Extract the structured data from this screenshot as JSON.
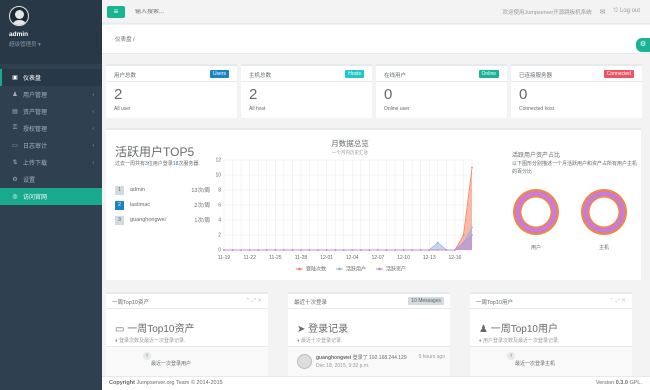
{
  "sidebar": {
    "user": "admin",
    "role": "超级管理员",
    "items": [
      {
        "label": "仪表盘",
        "icon": "dashboard-icon",
        "glyph": "▣",
        "arrow": ""
      },
      {
        "label": "用户管理",
        "icon": "users-icon",
        "glyph": "♟",
        "arrow": "‹"
      },
      {
        "label": "资产管理",
        "icon": "server-icon",
        "glyph": "▤",
        "arrow": "‹"
      },
      {
        "label": "授权管理",
        "icon": "lock-icon",
        "glyph": "⚿",
        "arrow": "‹"
      },
      {
        "label": "日志审计",
        "icon": "log-icon",
        "glyph": "▭",
        "arrow": "‹"
      },
      {
        "label": "上传下载",
        "icon": "upload-icon",
        "glyph": "⇅",
        "arrow": "‹"
      },
      {
        "label": "设置",
        "icon": "gear-icon",
        "glyph": "⚙",
        "arrow": ""
      },
      {
        "label": "访问官网",
        "icon": "globe-icon",
        "glyph": "◎",
        "arrow": ""
      }
    ]
  },
  "topbar": {
    "menu_glyph": "≡",
    "search_placeholder": "输入搜索...",
    "welcome": "欢迎使用Jumpserver开源跳板机系统",
    "logout": "Log out"
  },
  "breadcrumb": "仪表盘 /",
  "stats": [
    {
      "title": "用户总数",
      "badge": "Users",
      "badge_color": "#1c84c6",
      "value": "2",
      "sub": "All user"
    },
    {
      "title": "主机总数",
      "badge": "Hosts",
      "badge_color": "#23c6c8",
      "value": "2",
      "sub": "All host"
    },
    {
      "title": "在线用户",
      "badge": "Online",
      "badge_color": "#1ab394",
      "value": "0",
      "sub": "Online user"
    },
    {
      "title": "已连接服务器",
      "badge": "Connected",
      "badge_color": "#ed5565",
      "value": "0",
      "sub": "Connected host"
    }
  ],
  "top5": {
    "title": "活跃用户TOP5",
    "desc_pre": "过去一周共有",
    "desc_users": "3",
    "desc_mid": "位用户登录",
    "desc_hosts": "18",
    "desc_post": "次服务器.",
    "ranks": [
      {
        "num": "1",
        "name": "admin",
        "count": "13次/周"
      },
      {
        "num": "2",
        "name": "lastimac",
        "count": "2次/周"
      },
      {
        "num": "3",
        "name": "guanghongwei",
        "count": "1次/周"
      }
    ]
  },
  "chart_data": {
    "type": "area",
    "title": "月数据总览",
    "subtitle": "一个月内历史汇总",
    "categories": [
      "11-19",
      "11-20",
      "11-21",
      "11-22",
      "11-23",
      "11-24",
      "11-25",
      "11-26",
      "11-27",
      "11-28",
      "11-29",
      "11-30",
      "12-01",
      "12-02",
      "12-03",
      "12-04",
      "12-05",
      "12-06",
      "12-07",
      "12-08",
      "12-09",
      "12-10",
      "12-11",
      "12-12",
      "12-13",
      "12-14",
      "12-15",
      "12-16",
      "12-17",
      "12-18"
    ],
    "xticks": [
      "11-19",
      "11-22",
      "11-25",
      "11-28",
      "12-01",
      "12-04",
      "12-07",
      "12-10",
      "12-13",
      "12-16"
    ],
    "ylim": [
      0,
      12
    ],
    "yticks": [
      0,
      2,
      4,
      6,
      8,
      10,
      12
    ],
    "grid": true,
    "legend_position": "bottom",
    "series": [
      {
        "name": "登陆次数",
        "color": "#f47f60",
        "values": [
          0,
          0,
          0,
          0,
          0,
          0,
          0,
          0,
          0,
          0,
          0,
          0,
          0,
          0,
          0,
          0,
          0,
          0,
          0,
          0,
          0,
          0,
          0,
          0,
          0,
          0,
          0,
          0,
          2,
          11
        ]
      },
      {
        "name": "活跃用户",
        "color": "#8db6e0",
        "values": [
          0,
          0,
          0,
          0,
          0,
          0,
          0,
          0,
          0,
          0,
          0,
          0,
          0,
          0,
          0,
          0,
          0,
          0,
          0,
          0,
          0,
          0,
          0,
          0,
          0,
          1,
          0,
          0,
          1,
          3
        ]
      },
      {
        "name": "活跃资产",
        "color": "#c78ad9",
        "values": [
          0,
          0,
          0,
          0,
          0,
          0,
          0,
          0,
          0,
          0,
          0,
          0,
          0,
          0,
          0,
          0,
          0,
          0,
          0,
          0,
          0,
          0,
          0,
          0,
          0,
          0,
          0,
          0,
          1,
          2
        ]
      }
    ]
  },
  "pie": {
    "title": "活跃用户资产占比",
    "desc": "以下图形分别描述一个月活跃用户和资产占所有用户主机的百分比",
    "charts": [
      {
        "label": "用户",
        "ring_color": "#c97bd6",
        "center_color": "#ffffff",
        "active_percent": 100
      },
      {
        "label": "主机",
        "ring_color": "#c97bd6",
        "center_color": "#ffffff",
        "active_percent": 100
      }
    ],
    "accent_color": "#f0893f"
  },
  "panels": [
    {
      "head": "一周Top10资产",
      "big": "一周Top10资产",
      "big_icon": "inbox-icon",
      "big_glyph": "▭",
      "sub": "♦ 登录次数及最近一次登录记录.",
      "footer": "最近一次登录用户",
      "footer_icon": "info-icon"
    },
    {
      "head": "最近十次登录",
      "badge": "10 Messages",
      "big": "登录记录",
      "big_icon": "paper-plane-icon",
      "big_glyph": "➤",
      "sub": "♦ 最近十次登录记录.",
      "login_user": "guanghongwei",
      "login_action": " 登录了 192.168.244.129",
      "login_date": "Dec 18, 2015, 9:32 p.m.",
      "login_time": "5 hours ago"
    },
    {
      "head": "一周Top10用户",
      "big": "一周Top10用户",
      "big_icon": "user-icon",
      "big_glyph": "♟",
      "sub": "♦ 用户登录次数及最近一次登录记录.",
      "footer": "最近一次登录主机",
      "footer_icon": "info-icon"
    }
  ],
  "footer": {
    "left_bold": "Copyright",
    "left": " Jumpserver.org Team © 2014-2015",
    "right": "Version ",
    "version": "0.3.0",
    "right_post": " GPL."
  }
}
